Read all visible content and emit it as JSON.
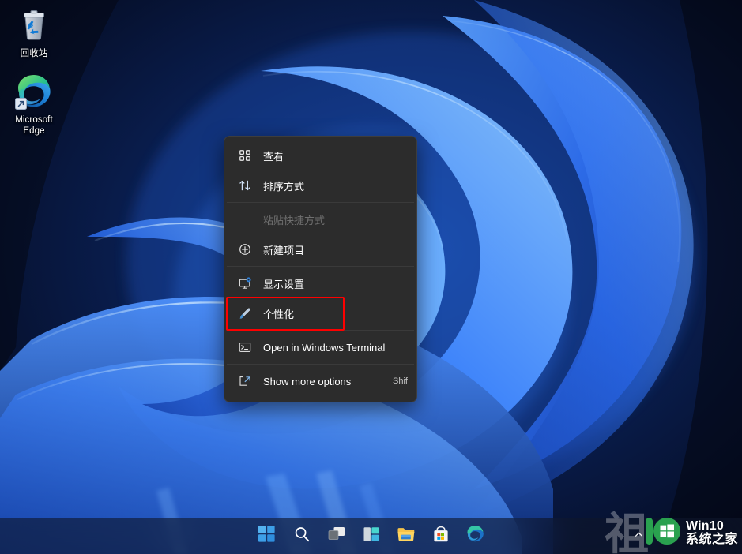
{
  "desktop": {
    "icons": [
      {
        "name": "recycle-bin",
        "label": "回收站"
      },
      {
        "name": "microsoft-edge",
        "label": "Microsoft\nEdge",
        "label_line1": "Microsoft",
        "label_line2": "Edge"
      }
    ]
  },
  "context_menu": {
    "items": [
      {
        "id": "view",
        "label": "查看",
        "icon": "grid-icon",
        "accel": "",
        "disabled": false,
        "highlighted": false
      },
      {
        "id": "sort-by",
        "label": "排序方式",
        "icon": "sort-arrows-icon",
        "accel": "",
        "disabled": false,
        "highlighted": false
      },
      {
        "id": "paste-shortcut",
        "label": "粘贴快捷方式",
        "icon": "",
        "accel": "",
        "disabled": true,
        "highlighted": false
      },
      {
        "id": "new-item",
        "label": "新建项目",
        "icon": "plus-circle-icon",
        "accel": "",
        "disabled": false,
        "highlighted": false
      },
      {
        "id": "display-settings",
        "label": "显示设置",
        "icon": "monitor-icon",
        "accel": "",
        "disabled": false,
        "highlighted": false
      },
      {
        "id": "personalize",
        "label": "个性化",
        "icon": "paintbrush-icon",
        "accel": "",
        "disabled": false,
        "highlighted": true
      },
      {
        "id": "open-terminal",
        "label": "Open in Windows Terminal",
        "icon": "terminal-icon",
        "accel": "",
        "disabled": false,
        "highlighted": false
      },
      {
        "id": "show-more-options",
        "label": "Show more options",
        "icon": "expand-box-icon",
        "accel": "Shif",
        "disabled": false,
        "highlighted": false
      }
    ],
    "separator_after": [
      "sort-by",
      "new-item",
      "personalize",
      "open-terminal"
    ],
    "highlight_color": "#fe0000",
    "background_color": "#2c2c2c"
  },
  "taskbar": {
    "buttons": [
      {
        "id": "start",
        "label": "Start",
        "icon": "windows-logo-icon"
      },
      {
        "id": "search",
        "label": "Search",
        "icon": "search-icon"
      },
      {
        "id": "task-view",
        "label": "Task View",
        "icon": "task-view-icon"
      },
      {
        "id": "widgets",
        "label": "Widgets",
        "icon": "widgets-icon"
      },
      {
        "id": "file-explorer",
        "label": "File Explorer",
        "icon": "folder-icon"
      },
      {
        "id": "microsoft-store",
        "label": "Microsoft Store",
        "icon": "store-bag-icon"
      },
      {
        "id": "edge",
        "label": "Microsoft Edge",
        "icon": "edge-icon"
      }
    ],
    "tray": [
      {
        "id": "show-hidden-icons",
        "label": "^",
        "icon": "chevron-up-icon"
      }
    ]
  },
  "watermark": {
    "line1": "Win10",
    "line2": "系统之家",
    "logo_digit": "10",
    "logo_color": "#2aa14f",
    "ghost_glyph": "祖"
  }
}
